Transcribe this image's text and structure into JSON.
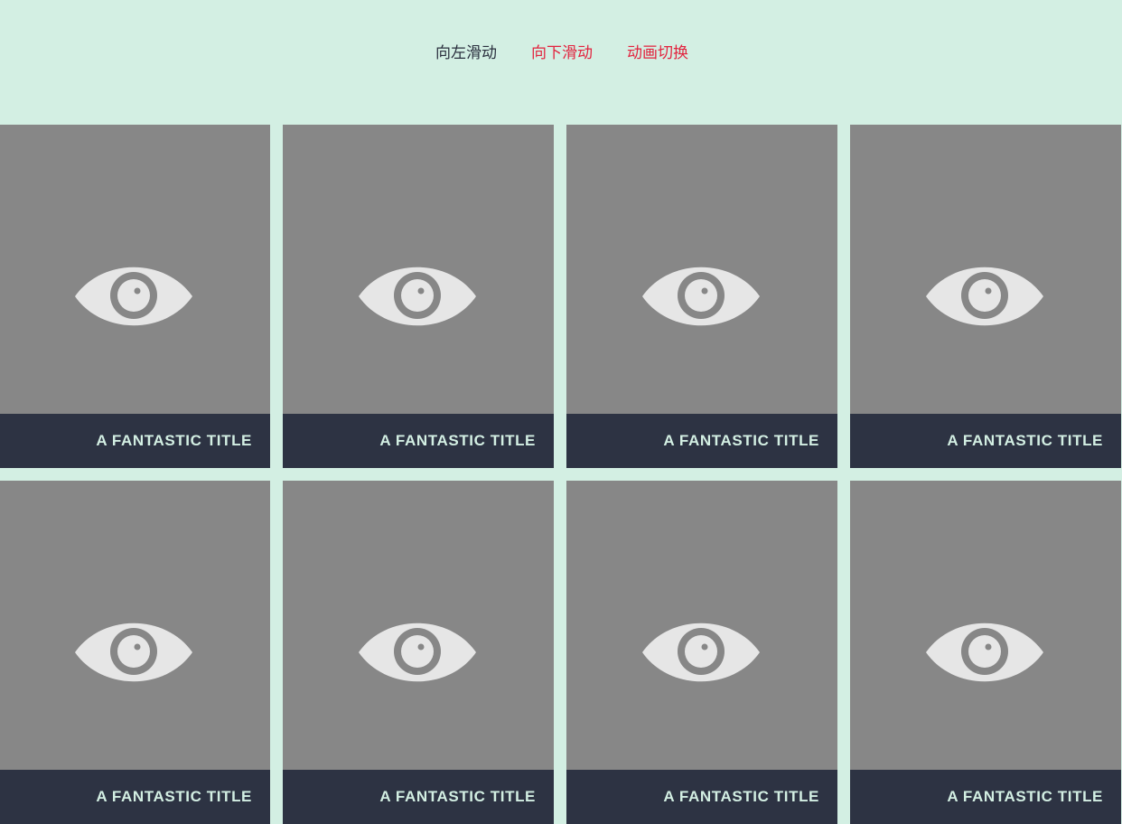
{
  "nav": {
    "items": [
      {
        "label": "向左滑动",
        "state": "active"
      },
      {
        "label": "向下滑动",
        "state": "inactive"
      },
      {
        "label": "动画切换",
        "state": "inactive"
      }
    ]
  },
  "colors": {
    "background": "#d3efe3",
    "card": "#878787",
    "caption_bg": "#2d3343",
    "caption_text": "#d3efe3",
    "nav_active": "#2a2f3e",
    "nav_inactive": "#e2233e",
    "eye": "#e6e6e6"
  },
  "cards": [
    {
      "title": "A FANTASTIC TITLE",
      "icon": "eye-icon"
    },
    {
      "title": "A FANTASTIC TITLE",
      "icon": "eye-icon"
    },
    {
      "title": "A FANTASTIC TITLE",
      "icon": "eye-icon"
    },
    {
      "title": "A FANTASTIC TITLE",
      "icon": "eye-icon"
    },
    {
      "title": "A FANTASTIC TITLE",
      "icon": "eye-icon"
    },
    {
      "title": "A FANTASTIC TITLE",
      "icon": "eye-icon"
    },
    {
      "title": "A FANTASTIC TITLE",
      "icon": "eye-icon"
    },
    {
      "title": "A FANTASTIC TITLE",
      "icon": "eye-icon"
    }
  ]
}
